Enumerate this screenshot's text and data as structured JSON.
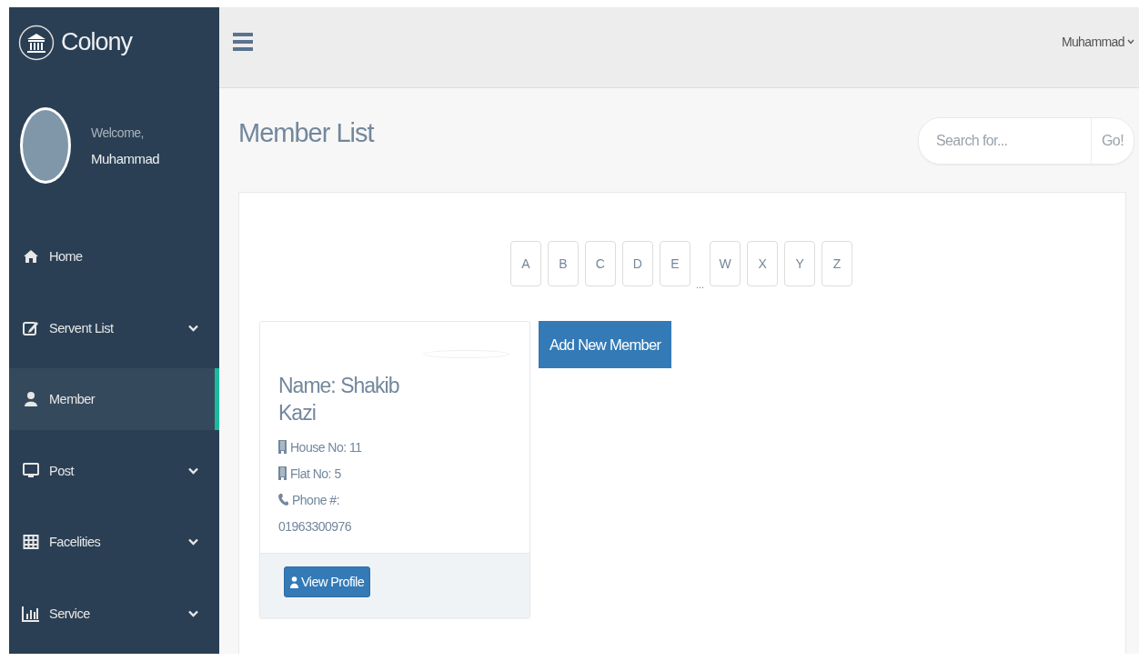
{
  "sidebar": {
    "brand": "Colony",
    "welcome": "Welcome,",
    "user_name": "Muhammad",
    "items": [
      {
        "label": "Home",
        "selected": false,
        "expandable": false
      },
      {
        "label": "Servent List",
        "selected": false,
        "expandable": true
      },
      {
        "label": "Member",
        "selected": true,
        "expandable": false
      },
      {
        "label": "Post",
        "selected": false,
        "expandable": true
      },
      {
        "label": "Facelities",
        "selected": false,
        "expandable": true
      },
      {
        "label": "Service",
        "selected": false,
        "expandable": true
      }
    ]
  },
  "top_bar": {
    "user_menu": "Muhammad"
  },
  "page": {
    "title": "Member List",
    "search": {
      "placeholder": "Search for...",
      "button": "Go!"
    },
    "letters": [
      {
        "kind": "letter",
        "label": "A"
      },
      {
        "kind": "letter",
        "label": "B"
      },
      {
        "kind": "letter",
        "label": "C"
      },
      {
        "kind": "letter",
        "label": "D"
      },
      {
        "kind": "letter",
        "label": "E"
      },
      {
        "kind": "ellipsis",
        "label": "..."
      },
      {
        "kind": "letter",
        "label": "W"
      },
      {
        "kind": "letter",
        "label": "X"
      },
      {
        "kind": "letter",
        "label": "Y"
      },
      {
        "kind": "letter",
        "label": "Z"
      }
    ],
    "members": [
      {
        "name": "Name: Shakib Kazi",
        "house": "House No: 11",
        "flat": "Flat No: 5",
        "phone_label": "Phone #:",
        "phone": "01963300976",
        "button": "View Profile"
      }
    ],
    "add_button": "Add New Member"
  }
}
